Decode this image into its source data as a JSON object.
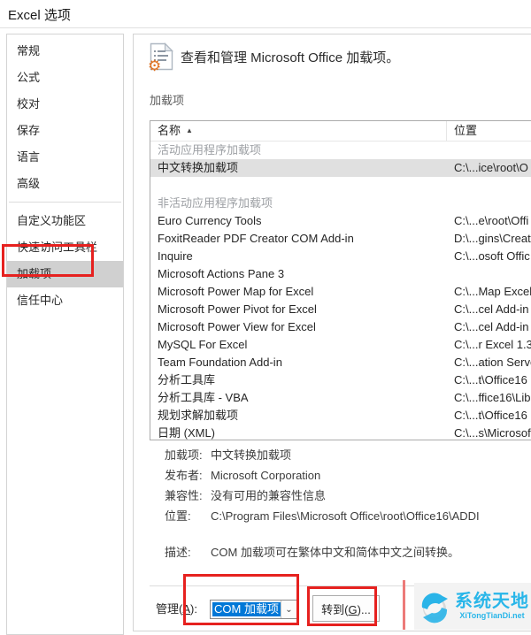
{
  "window": {
    "title": "Excel 选项"
  },
  "colors": {
    "annotation_red": "#e6211f",
    "selection_blue": "#0078d7",
    "watermark_cyan": "#29b6e9",
    "selected_row_gray": "#e0e0e0",
    "sidebar_selected_gray": "#d0d0d0",
    "gear_orange": "#e0711f"
  },
  "sidebar": {
    "items": [
      {
        "label": "常规",
        "selected": false
      },
      {
        "label": "公式",
        "selected": false
      },
      {
        "label": "校对",
        "selected": false
      },
      {
        "label": "保存",
        "selected": false
      },
      {
        "label": "语言",
        "selected": false
      },
      {
        "label": "高级",
        "selected": false
      },
      {
        "label": "自定义功能区",
        "selected": false
      },
      {
        "label": "快速访问工具栏",
        "selected": false
      },
      {
        "label": "加载项",
        "selected": true
      },
      {
        "label": "信任中心",
        "selected": false
      }
    ]
  },
  "main": {
    "header_text": "查看和管理 Microsoft Office 加载项。",
    "section_label": "加载项",
    "table": {
      "name_header": "名称",
      "sort_icon": "▲",
      "location_header": "位置",
      "rows": [
        {
          "type": "group",
          "name": "活动应用程序加载项",
          "location": ""
        },
        {
          "type": "item",
          "name": "中文转换加载项",
          "location": "C:\\...ice\\root\\O",
          "selected": true
        },
        {
          "type": "spacer",
          "name": "",
          "location": ""
        },
        {
          "type": "group",
          "name": "非活动应用程序加载项",
          "location": ""
        },
        {
          "type": "item",
          "name": "Euro Currency Tools",
          "location": "C:\\...e\\root\\Offi"
        },
        {
          "type": "item",
          "name": "FoxitReader PDF Creator COM Add-in",
          "location": "D:\\...gins\\Creat"
        },
        {
          "type": "item",
          "name": "Inquire",
          "location": "C:\\...osoft Offic"
        },
        {
          "type": "item",
          "name": "Microsoft Actions Pane 3",
          "location": ""
        },
        {
          "type": "item",
          "name": "Microsoft Power Map for Excel",
          "location": "C:\\...Map Excel"
        },
        {
          "type": "item",
          "name": "Microsoft Power Pivot for Excel",
          "location": "C:\\...cel Add-in"
        },
        {
          "type": "item",
          "name": "Microsoft Power View for Excel",
          "location": "C:\\...cel Add-in"
        },
        {
          "type": "item",
          "name": "MySQL For Excel",
          "location": "C:\\...r Excel 1.3"
        },
        {
          "type": "item",
          "name": "Team Foundation Add-in",
          "location": "C:\\...ation Serve"
        },
        {
          "type": "item",
          "name": "分析工具库",
          "location": "C:\\...t\\Office16"
        },
        {
          "type": "item",
          "name": "分析工具库 - VBA",
          "location": "C:\\...ffice16\\Lib"
        },
        {
          "type": "item",
          "name": "规划求解加载项",
          "location": "C:\\...t\\Office16"
        },
        {
          "type": "item",
          "name": "日期 (XML)",
          "location": "C:\\...s\\Microsof"
        }
      ]
    },
    "details": {
      "rows": [
        {
          "label": "加载项:",
          "value": "中文转换加载项"
        },
        {
          "label": "发布者:",
          "value": "Microsoft Corporation"
        },
        {
          "label": "兼容性:",
          "value": "没有可用的兼容性信息"
        },
        {
          "label": "位置:",
          "value": "C:\\Program Files\\Microsoft Office\\root\\Office16\\ADDI"
        },
        {
          "label": "描述:",
          "value": "COM 加载项可在繁体中文和简体中文之间转换。"
        }
      ]
    },
    "footer": {
      "manage_pre": "管理(",
      "manage_key": "A",
      "manage_post": "):",
      "manage_value": "COM 加载项",
      "dropdown_arrow": "⌄",
      "goto_pre": "转到(",
      "goto_key": "G",
      "goto_post": ")..."
    }
  },
  "watermark": {
    "title": "系统天地",
    "subtitle": "XiTongTianDi.net"
  }
}
